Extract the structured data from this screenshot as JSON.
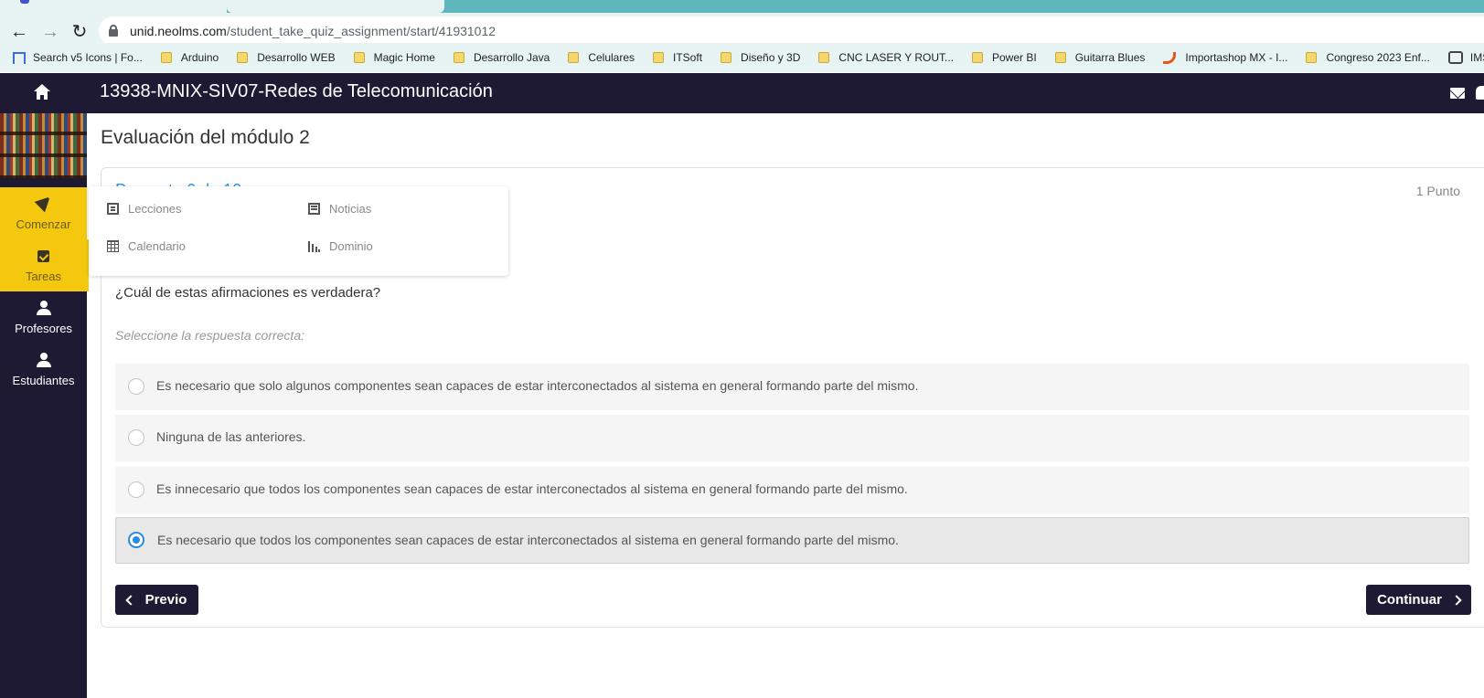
{
  "browser": {
    "url_host": "unid.neolms.com",
    "url_path": "/student_take_quiz_assignment/start/41931012",
    "bookmarks": [
      {
        "label": "Search v5 Icons | Fo...",
        "icon": "flag-icon"
      },
      {
        "label": "Arduino",
        "icon": "folder-icon"
      },
      {
        "label": "Desarrollo WEB",
        "icon": "folder-icon"
      },
      {
        "label": "Magic Home",
        "icon": "folder-icon"
      },
      {
        "label": "Desarrollo Java",
        "icon": "folder-icon"
      },
      {
        "label": "Celulares",
        "icon": "folder-icon"
      },
      {
        "label": "ITSoft",
        "icon": "folder-icon"
      },
      {
        "label": "Diseño y 3D",
        "icon": "folder-icon"
      },
      {
        "label": "CNC LASER Y ROUT...",
        "icon": "folder-icon"
      },
      {
        "label": "Power BI",
        "icon": "folder-icon"
      },
      {
        "label": "Guitarra Blues",
        "icon": "folder-icon"
      },
      {
        "label": "Importashop MX - I...",
        "icon": "importashop-icon"
      },
      {
        "label": "Congreso 2023 Enf...",
        "icon": "folder-icon"
      },
      {
        "label": "IMSS",
        "icon": "imss-icon"
      },
      {
        "label": "@",
        "icon": "folder-icon"
      }
    ]
  },
  "header": {
    "course_title": "13938-MNIX-SIV07-Redes de Telecomunicación"
  },
  "sidebar": {
    "items": [
      {
        "label": "Comenzar",
        "icon": "navigation-arrow-icon"
      },
      {
        "label": "Tareas",
        "icon": "checkbox-icon"
      },
      {
        "label": "Profesores",
        "icon": "person-icon"
      },
      {
        "label": "Estudiantes",
        "icon": "person-icon"
      }
    ]
  },
  "popover": {
    "items": [
      {
        "label": "Lecciones",
        "icon": "book-icon"
      },
      {
        "label": "Noticias",
        "icon": "newspaper-icon"
      },
      {
        "label": "Calendario",
        "icon": "calendar-icon"
      },
      {
        "label": "Dominio",
        "icon": "bar-chart-icon"
      }
    ]
  },
  "quiz": {
    "page_title": "Evaluación del módulo 2",
    "question_counter": "Pregunta 6 de 10",
    "points": "1 Punto",
    "question": "¿Cuál de estas afirmaciones es verdadera?",
    "instruction": "Seleccione la respuesta correcta:",
    "options": [
      {
        "text": "Es necesario que solo algunos componentes sean capaces de estar interconectados al sistema en general formando parte del mismo.",
        "selected": false
      },
      {
        "text": "Ninguna de las anteriores.",
        "selected": false
      },
      {
        "text": "Es innecesario que todos los componentes sean capaces de estar interconectados al sistema en general formando parte del mismo.",
        "selected": false
      },
      {
        "text": "Es necesario que todos los componentes sean capaces de estar interconectados al sistema en general formando parte del mismo.",
        "selected": true
      }
    ],
    "prev_label": "Previo",
    "next_label": "Continuar"
  },
  "colors": {
    "header_bg": "#1e1a33",
    "sidebar_active": "#f4c80e",
    "accent": "#2a8ae0",
    "browser_chrome": "#e8f4f4",
    "tab_strip": "#5fb7bd"
  }
}
